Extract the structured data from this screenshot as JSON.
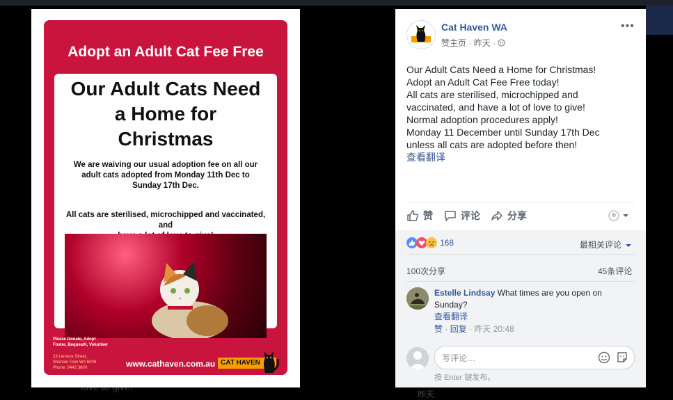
{
  "poster": {
    "banner": "Adopt an Adult Cat Fee Free",
    "headline_1": "Our Adult Cats Need",
    "headline_2": "a Home for",
    "headline_3": "Christmas",
    "body_1": "We are waiving our usual adoption fee on all our",
    "body_2": "adult cats adopted from Monday 11th Dec to",
    "body_3": "Sunday 17th Dec.",
    "body_4": "All cats are sterilised, microchipped and vaccinated, and",
    "body_5": "have a lot of love to give!",
    "footer_1": "Please Donate, Adopt",
    "footer_2": "Foster, Bequeath, Volunteer",
    "address_1": "23 Lemnos Street,",
    "address_2": "Shenton Park WA 6008",
    "address_3": "Phone: 9442 3600",
    "url": "www.cathaven.com.au",
    "logo_text": "CAT HAVEN"
  },
  "post": {
    "page_name": "Cat Haven WA",
    "meta_link": "赞主页",
    "meta_sep": "·",
    "meta_time": "昨天",
    "lines": [
      "Our Adult Cats Need a Home for Christmas!",
      "Adopt an Adult Cat Fee Free today!",
      "All cats are sterilised, microchipped and",
      "vaccinated, and have a lot of love to give!",
      "Normal adoption procedures apply!",
      "Monday 11 December until Sunday 17th Dec",
      "unless all cats are adopted before then!"
    ],
    "see_translation": "查看翻译"
  },
  "actions": {
    "like": "赞",
    "comment": "评论",
    "share": "分享"
  },
  "feedback": {
    "reaction_count": "168",
    "sort_label": "最相关评论",
    "shares": "100次分享",
    "comments": "45条评论"
  },
  "comment": {
    "author": "Estelle Lindsay",
    "text": "What times are you open on Sunday?",
    "translate": "查看翻译",
    "like": "赞",
    "reply": "回复",
    "sep": "·",
    "time": "昨天 20:48"
  },
  "composer": {
    "placeholder": "写评论…",
    "hint": "按 Enter 键发布。"
  },
  "background": {
    "left_text": "love to give!",
    "right_text": "昨天"
  },
  "colors": {
    "brand_red": "#c9143d",
    "link_blue": "#365899",
    "logo_orange": "#f5a000"
  }
}
